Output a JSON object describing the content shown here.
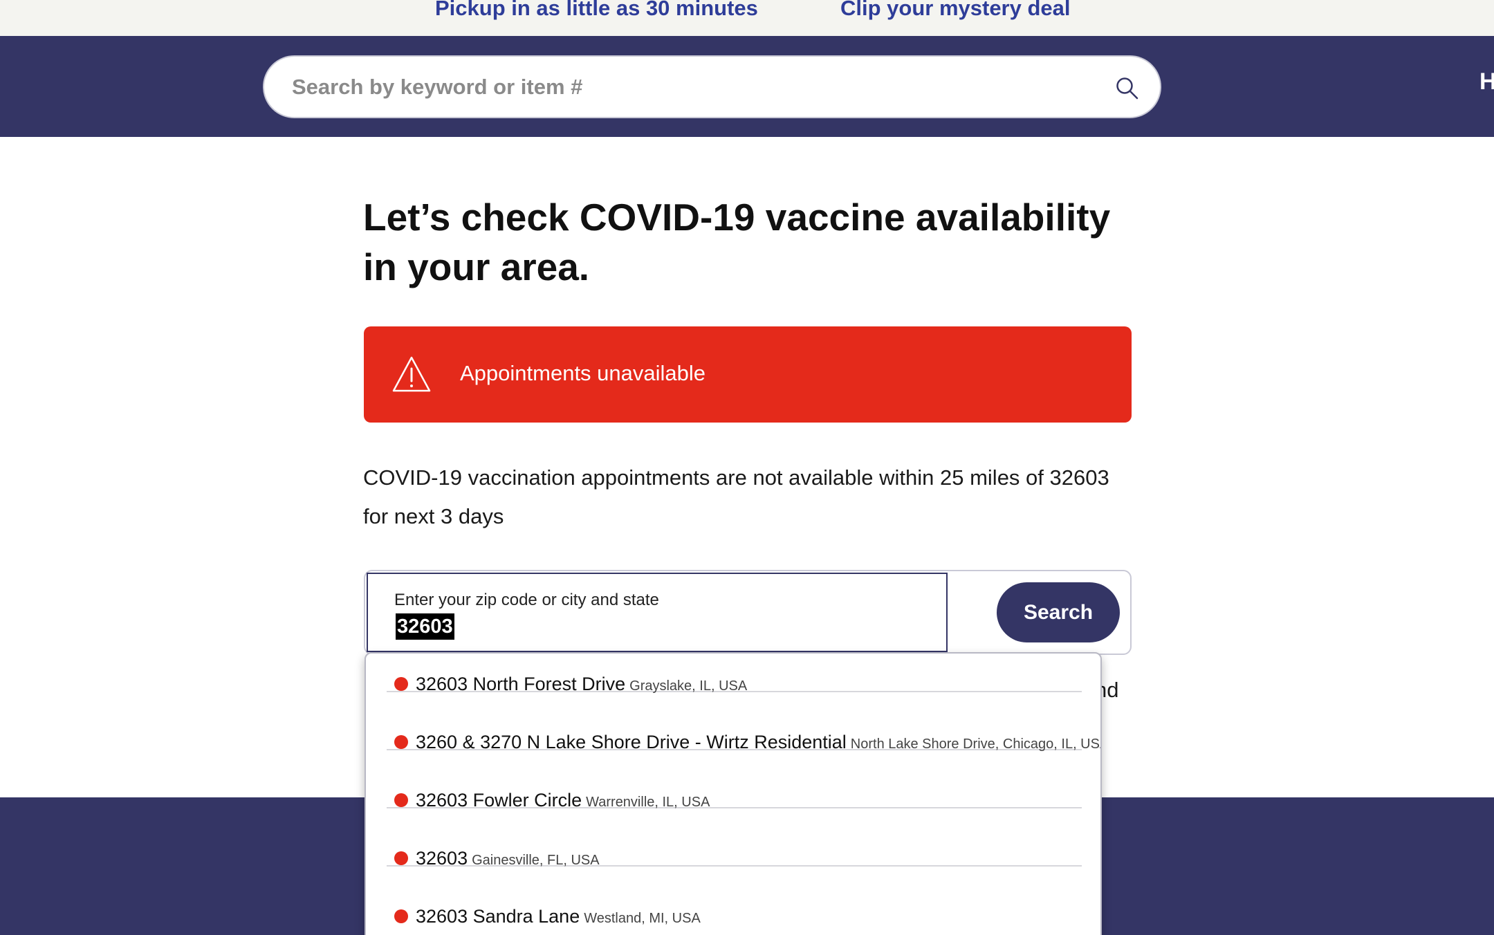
{
  "promo": {
    "link1": "Pickup in as little as 30 minutes",
    "link2": "Clip your mystery deal"
  },
  "header": {
    "search_placeholder": "Search by keyword or item #",
    "cut_text": "H"
  },
  "main": {
    "title": "Let’s check COVID-19 vaccine availability in your area.",
    "alert_text": "Appointments unavailable",
    "message": "COVID-19 vaccination appointments are not available within 25 miles of 32603 for next 3 days",
    "zip_label": "Enter your zip code or city and state",
    "zip_value": "32603",
    "search_button": "Search",
    "behind_text": "nd"
  },
  "suggestions": [
    {
      "main": "32603 North Forest Drive",
      "sub": "Grayslake, IL, USA"
    },
    {
      "main": "3260 & 3270 N Lake Shore Drive - Wirtz Residential",
      "sub": "North Lake Shore Drive, Chicago, IL, USA"
    },
    {
      "main": "32603 Fowler Circle",
      "sub": "Warrenville, IL, USA"
    },
    {
      "main": "32603",
      "sub": "Gainesville, FL, USA"
    },
    {
      "main": "32603 Sandra Lane",
      "sub": "Westland, MI, USA"
    }
  ],
  "colors": {
    "navy": "#343565",
    "alert_red": "#e42a1b",
    "promo_blue": "#2e3d99"
  },
  "icons": [
    "search-icon",
    "warning-icon",
    "location-dot-icon"
  ]
}
